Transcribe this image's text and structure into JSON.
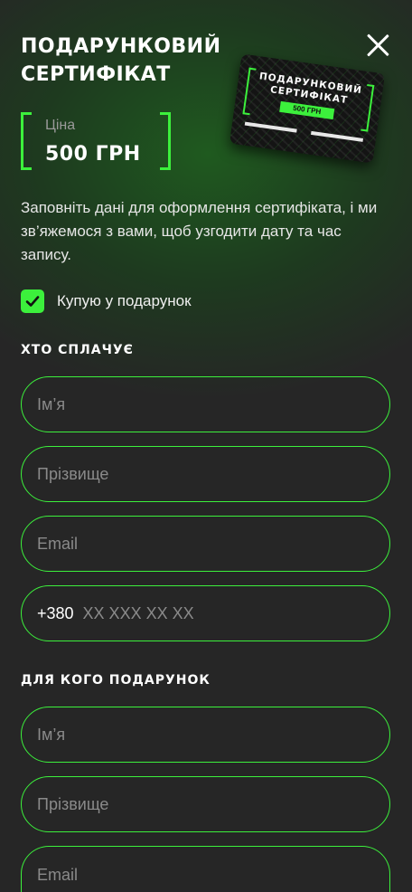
{
  "header": {
    "title": "ПОДАРУНКОВИЙ СЕРТИФІКАТ",
    "close_icon": "close-icon"
  },
  "price": {
    "label": "Ціна",
    "value": "500 ГРН"
  },
  "card": {
    "title": "ПОДАРУНКОВИЙ СЕРТИФІКАТ",
    "price": "500 ГРН"
  },
  "description": "Заповніть дані для оформлення сертифіката, і ми зв’яжемося з вами, щоб узгодити дату та час запису.",
  "gift_checkbox": {
    "label": "Купую у подарунок",
    "checked": true
  },
  "payer": {
    "heading": "ХТО СПЛАЧУЄ",
    "name_placeholder": "Ім’я",
    "surname_placeholder": "Прізвище",
    "email_placeholder": "Email",
    "phone_prefix": "+380",
    "phone_placeholder": "XX XXX XX XX"
  },
  "recipient": {
    "heading": "ДЛЯ КОГО ПОДАРУНОК",
    "name_placeholder": "Ім’я",
    "surname_placeholder": "Прізвище",
    "email_placeholder": "Email"
  },
  "colors": {
    "accent": "#3cf03c",
    "background": "#262626"
  }
}
